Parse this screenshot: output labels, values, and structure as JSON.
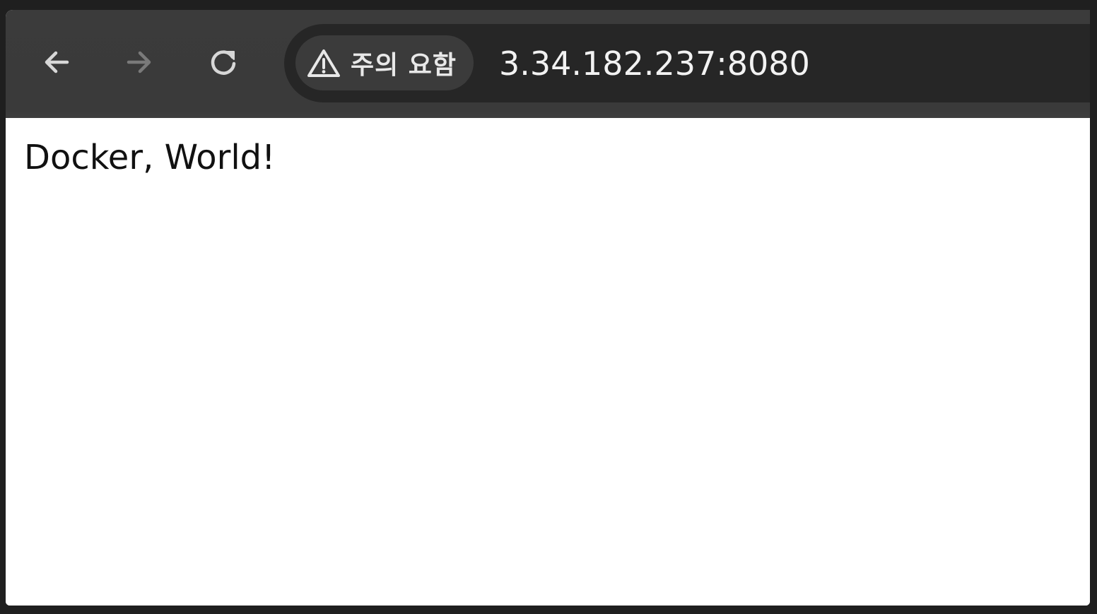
{
  "toolbar": {
    "back_icon": "arrow-left-icon",
    "forward_icon": "arrow-right-icon",
    "reload_icon": "reload-icon",
    "icon_color": "#d7d7d7",
    "disabled_icon_color": "#7a7a7a"
  },
  "omnibox": {
    "security_chip": {
      "icon": "warning-triangle-icon",
      "label": "주의 요함"
    },
    "url": "3.34.182.237:8080"
  },
  "page": {
    "body_text": "Docker, World!"
  },
  "colors": {
    "frame_background": "#1f1f1f",
    "toolbar_background": "#3a3a3a",
    "omnibox_background": "#262626",
    "chip_background": "#3b3b3b",
    "page_background": "#ffffff"
  }
}
